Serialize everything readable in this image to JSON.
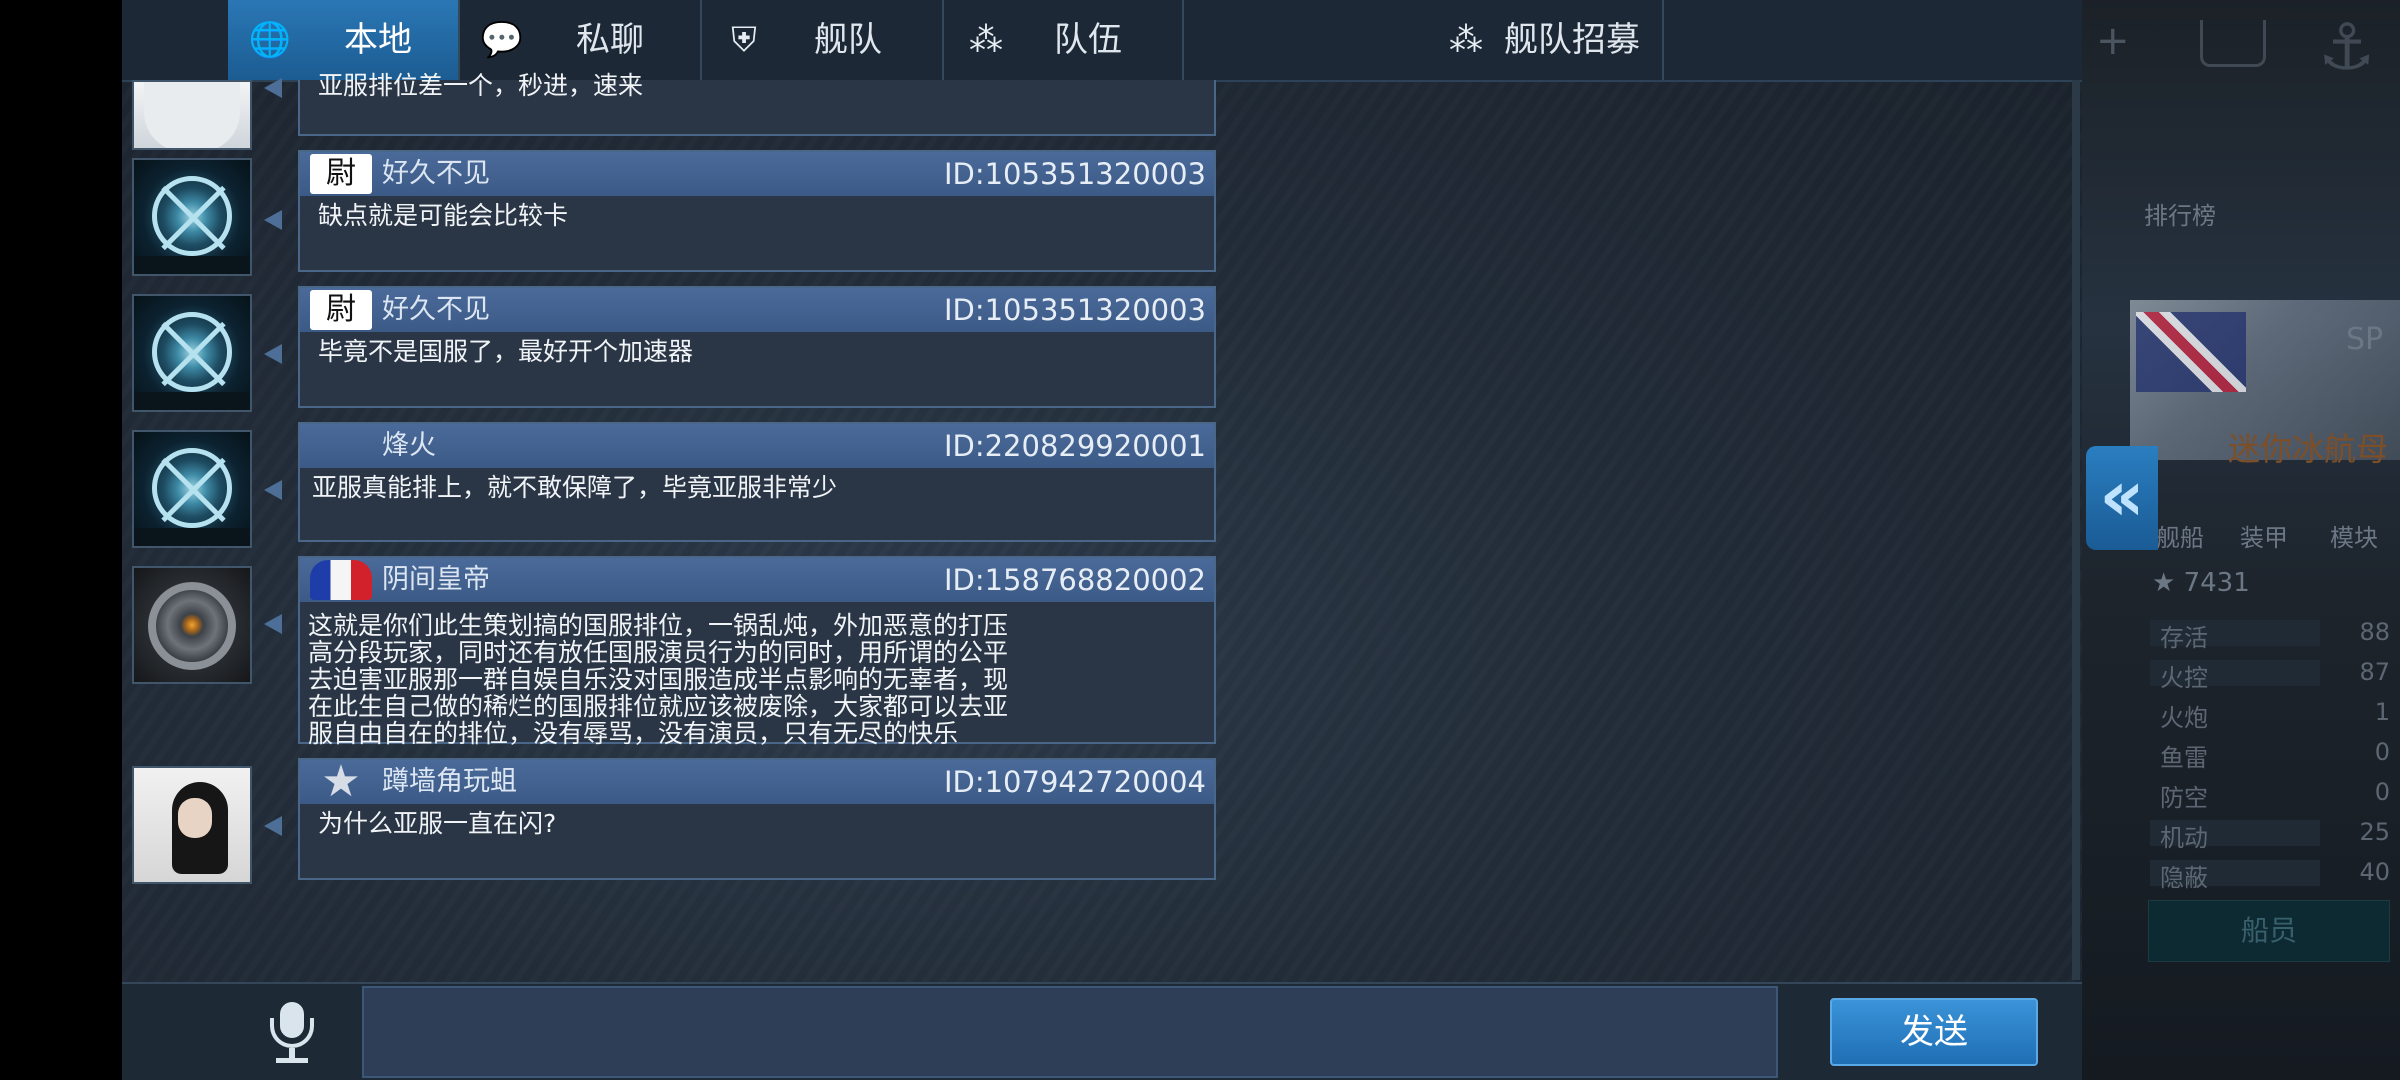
{
  "tabs": [
    {
      "label": "本地",
      "icon": "globe-icon",
      "active": true
    },
    {
      "label": "私聊",
      "icon": "chat-bubble-icon",
      "active": false
    },
    {
      "label": "舰队",
      "icon": "fleet-emblem-icon",
      "active": false
    },
    {
      "label": "队伍",
      "icon": "team-dots-icon",
      "active": false
    },
    {
      "label": "舰队招募",
      "icon": "team-dots-icon",
      "active": false
    }
  ],
  "messages": [
    {
      "name": "",
      "id": "",
      "text": "亚服排位差一个，秒进，速来",
      "avatar": "anime-girl"
    },
    {
      "name": "好久不见",
      "id": "ID:105351320003",
      "text": "缺点就是可能会比较卡",
      "avatar": "emblem",
      "badge": "calligraphy",
      "badge_text": "尉"
    },
    {
      "name": "好久不见",
      "id": "ID:105351320003",
      "text": "毕竟不是国服了，最好开个加速器",
      "avatar": "emblem",
      "badge": "calligraphy",
      "badge_text": "尉"
    },
    {
      "name": "烽火",
      "id": "ID:220829920001",
      "text": "亚服真能排上，就不敢保障了，毕竟亚服非常少",
      "avatar": "emblem",
      "badge": "none"
    },
    {
      "name": "阴间皇帝",
      "id": "ID:158768820002",
      "text": "这就是你们此生策划搞的国服排位，一锅乱炖，外加恶意的打压\n高分段玩家，同时还有放任国服演员行为的同时，用所谓的公平\n去迫害亚服那一群自娱自乐没对国服造成半点影响的无辜者，现\n在此生自己做的稀烂的国服排位就应该被废除，大家都可以去亚\n服自由自在的排位，没有辱骂，没有演员，只有无尽的快乐",
      "avatar": "gear",
      "badge": "french-flag"
    },
    {
      "name": "蹲墙角玩蛆",
      "id": "ID:107942720004",
      "text": "为什么亚服一直在闪?",
      "avatar": "girl-photo",
      "badge": "star"
    }
  ],
  "bottom": {
    "mic_icon": "microphone-icon",
    "input_value": "",
    "send_label": "发送"
  },
  "background": {
    "stars": "7431",
    "ship_name": "迷你冰航母",
    "sp_label": "SP",
    "ranking_label": "排行榜",
    "tabs": [
      "舰船",
      "装甲",
      "模块"
    ],
    "stats": [
      {
        "label": "存活",
        "value": "88"
      },
      {
        "label": "火控",
        "value": "87"
      },
      {
        "label": "火炮",
        "value": "1"
      },
      {
        "label": "鱼雷",
        "value": "0"
      },
      {
        "label": "防空",
        "value": "0"
      },
      {
        "label": "机动",
        "value": "25"
      },
      {
        "label": "隐蔽",
        "value": "40"
      }
    ],
    "crew_label": "船员"
  },
  "colors": {
    "accent_blue": "#2a77b5",
    "message_header": "#4a6a9a",
    "message_body": "#2a3646"
  }
}
